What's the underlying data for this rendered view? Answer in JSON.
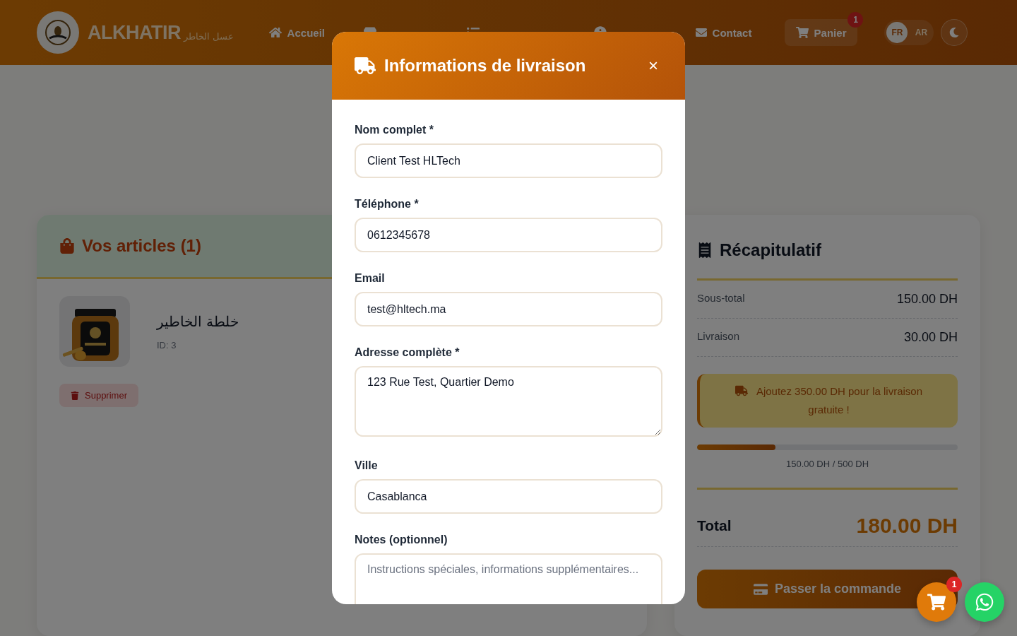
{
  "header": {
    "logo_text": "ALKHATIR",
    "logo_subtitle": "عسل الخاطر",
    "nav": [
      {
        "kind": "home",
        "label": "Accueil"
      },
      {
        "kind": "store"
      },
      {
        "kind": "list"
      },
      {
        "kind": "info"
      },
      {
        "kind": "mail",
        "label": "Contact"
      }
    ],
    "cart": {
      "label": "Panier",
      "badge": "1"
    },
    "languages": [
      {
        "label": "FR",
        "selected": true
      },
      {
        "label": "AR",
        "selected": false
      }
    ]
  },
  "cart_section": {
    "title": "Vos articles (1)",
    "items": [
      {
        "name": "خلطة الخاطير",
        "id_text": "ID: 3",
        "remove_label": "Supprimer"
      }
    ]
  },
  "summary": {
    "title": "Récapitulatif",
    "rows": [
      {
        "label": "Sous-total",
        "value": "150.00 DH"
      },
      {
        "label": "Livraison",
        "value": "30.00 DH"
      }
    ],
    "notice": "Ajoutez 350.00 DH pour la livraison gratuite !",
    "progress": {
      "level": 0.3,
      "reading": "150.00 DH / 500 DH"
    },
    "total": {
      "label": "Total",
      "value": "180.00 DH"
    },
    "checkout_label": "Passer la commande"
  },
  "modal": {
    "title": "Informations de livraison",
    "close": "×",
    "fields": [
      {
        "label": "Nom complet *",
        "kind": "input",
        "value": "Client Test HLTech"
      },
      {
        "label": "Téléphone *",
        "kind": "input",
        "value": "0612345678"
      },
      {
        "label": "Email",
        "kind": "input",
        "value": "test@hltech.ma"
      },
      {
        "label": "Adresse complète *",
        "kind": "textarea",
        "value": "123 Rue Test, Quartier Demo"
      },
      {
        "label": "Ville",
        "kind": "input",
        "value": "Casablanca"
      },
      {
        "label": "Notes (optionnel)",
        "kind": "textarea",
        "placeholder": "Instructions spéciales, informations supplémentaires..."
      }
    ]
  },
  "floating": {
    "cart_badge": "1"
  }
}
